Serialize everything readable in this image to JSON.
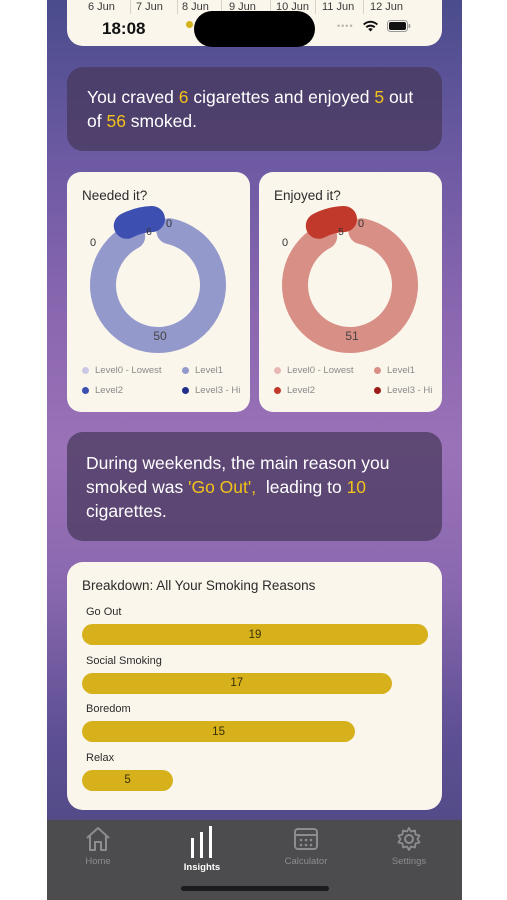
{
  "calendar": {
    "dates": [
      "6 Jun",
      "7 Jun",
      "8 Jun",
      "9 Jun",
      "10 Jun",
      "11 Jun",
      "12 Jun"
    ]
  },
  "status_bar": {
    "time": "18:08",
    "signal": "••••"
  },
  "summary": {
    "prefix": "You craved ",
    "craved": "6",
    "mid1": " cigarettes and enjoyed ",
    "enjoyed": "5",
    "mid2": " out of ",
    "smoked": "56",
    "suffix": " smoked."
  },
  "needed_chart": {
    "title": "Needed it?",
    "slices": [
      {
        "label": "Level0 - Lowest",
        "value": 0,
        "color": "#c9c9e6"
      },
      {
        "label": "Level1",
        "value": 50,
        "color": "#9499cc"
      },
      {
        "label": "Level2",
        "value": 6,
        "color": "#3d4fb0"
      },
      {
        "label": "Level3 - Hi",
        "value": 0,
        "color": "#1f2f8c"
      }
    ],
    "labels": {
      "main": "50",
      "small": "6",
      "zero_a": "0",
      "zero_b": "0"
    }
  },
  "enjoyed_chart": {
    "title": "Enjoyed it?",
    "slices": [
      {
        "label": "Level0 - Lowest",
        "value": 0,
        "color": "#e8b8b2"
      },
      {
        "label": "Level1",
        "value": 51,
        "color": "#d88f86"
      },
      {
        "label": "Level2",
        "value": 5,
        "color": "#c0392b"
      },
      {
        "label": "Level3 - Hi",
        "value": 0,
        "color": "#9b1c14"
      }
    ],
    "labels": {
      "main": "51",
      "small": "5",
      "zero_a": "0",
      "zero_b": "0"
    }
  },
  "weekend": {
    "prefix": "During weekends, the main reason you smoked was ",
    "reason": "'Go Out',",
    "mid": "  leading to ",
    "count": "10",
    "suffix": " cigarettes."
  },
  "chart_data": {
    "type": "bar",
    "title": "Breakdown: All Your Smoking Reasons",
    "categories": [
      "Go Out",
      "Social Smoking",
      "Boredom",
      "Relax"
    ],
    "values": [
      19,
      17,
      15,
      5
    ],
    "xlim": [
      0,
      19
    ],
    "bar_color": "#d6b11c"
  },
  "tabs": [
    {
      "label": "Home",
      "icon": "home-icon",
      "active": false
    },
    {
      "label": "Insights",
      "icon": "insights-icon",
      "active": true
    },
    {
      "label": "Calculator",
      "icon": "calculator-icon",
      "active": false
    },
    {
      "label": "Settings",
      "icon": "settings-icon",
      "active": false
    }
  ]
}
